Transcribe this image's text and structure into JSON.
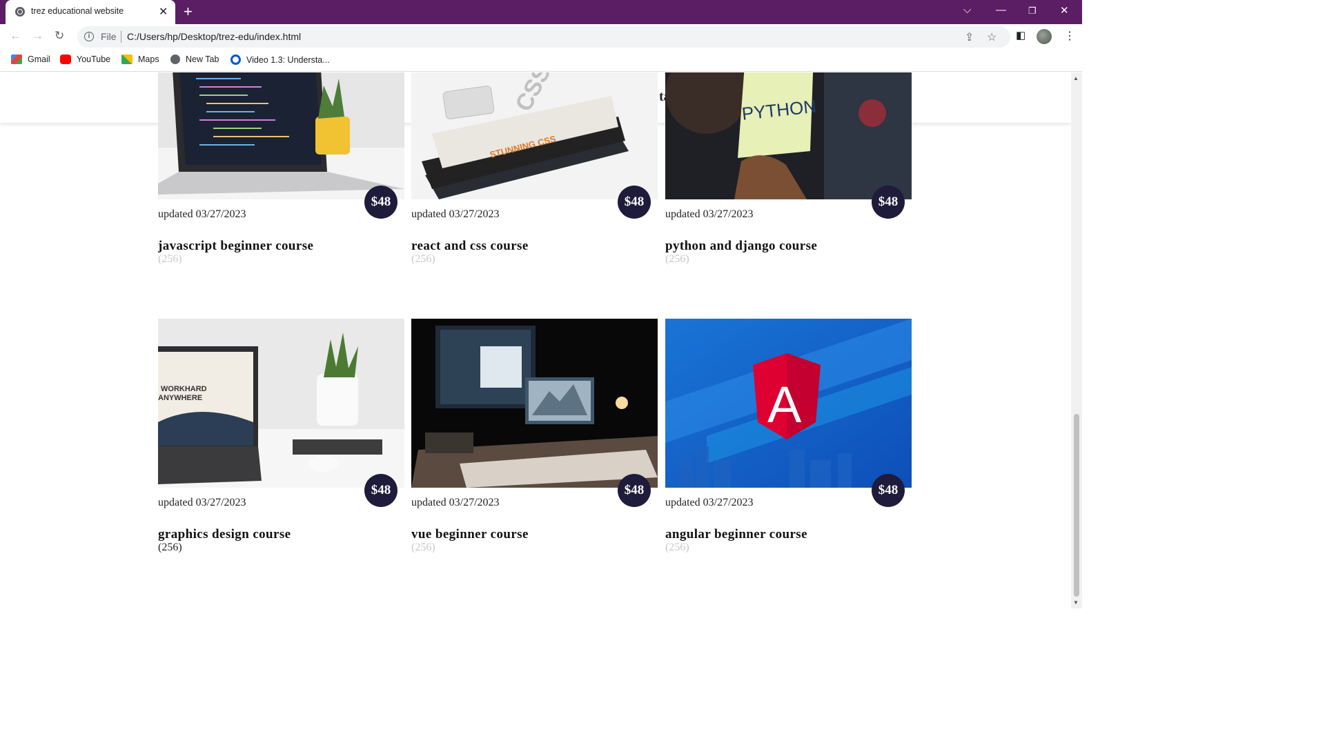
{
  "browser": {
    "tab_title": "trez educational website",
    "new_tab_symbol": "+",
    "close_symbol": "✕",
    "url_scheme": "File",
    "url": "C:/Users/hp/Desktop/trez-edu/index.html",
    "bookmarks": [
      {
        "label": "Gmail",
        "icon": "gmail-icon",
        "color": "#ea4335"
      },
      {
        "label": "YouTube",
        "icon": "youtube-icon",
        "color": "#ff0000"
      },
      {
        "label": "Maps",
        "icon": "maps-icon",
        "color": "#34a853"
      },
      {
        "label": "New Tab",
        "icon": "globe-icon",
        "color": "#5f6368"
      },
      {
        "label": "Video 1.3: Understa...",
        "icon": "coursera-icon",
        "color": "#0056d2"
      }
    ],
    "frame_color": "#5b1d63"
  },
  "page": {
    "header_fragment": "ta",
    "courses": [
      {
        "updated": "updated 03/27/2023",
        "title": "javascript beginner course",
        "rating": "(256)",
        "price": "$48",
        "image": "laptop-code-image"
      },
      {
        "updated": "updated 03/27/2023",
        "title": "react and css course",
        "rating": "(256)",
        "price": "$48",
        "image": "css-books-image"
      },
      {
        "updated": "updated 03/27/2023",
        "title": "python and django course",
        "rating": "(256)",
        "price": "$48",
        "image": "python-note-image"
      },
      {
        "updated": "updated 03/27/2023",
        "title": "graphics design course",
        "rating": "(256)",
        "price": "$48",
        "image": "workhard-laptop-image"
      },
      {
        "updated": "updated 03/27/2023",
        "title": "vue beginner course",
        "rating": "(256)",
        "price": "$48",
        "image": "dark-desk-image"
      },
      {
        "updated": "updated 03/27/2023",
        "title": "angular beginner course",
        "rating": "(256)",
        "price": "$48",
        "image": "angular-logo-image"
      }
    ],
    "image_text": {
      "css_book_1": "CSS",
      "css_book_2": "STUNNING CSS",
      "python_note": "PYTHON",
      "workhard": "WORKHARD",
      "anywhere": "ANYWHERE",
      "angular_letter": "A"
    },
    "badge_color": "#1f1b3b"
  }
}
